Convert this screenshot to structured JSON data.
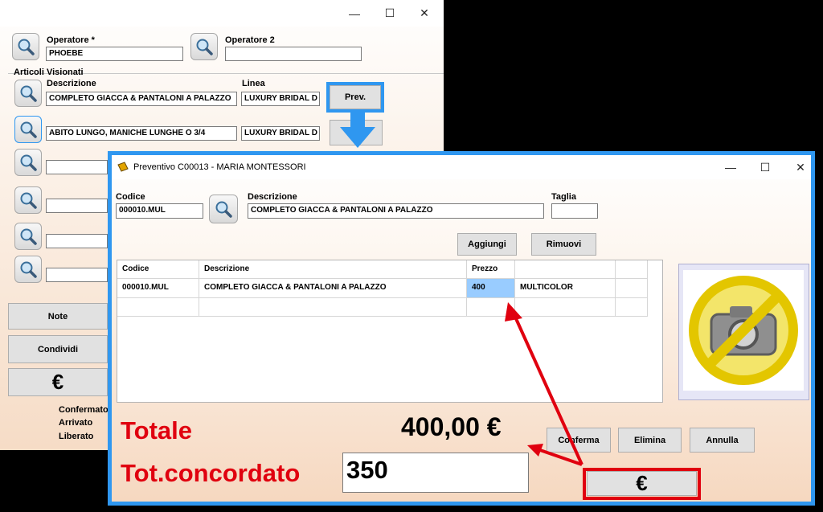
{
  "main_window": {
    "operatore_label": "Operatore *",
    "operatore_value": "PHOEBE",
    "operatore2_label": "Operatore 2",
    "operatore2_value": "",
    "group_label": "Articoli Visionati",
    "col_descrizione": "Descrizione",
    "col_linea": "Linea",
    "articles": [
      {
        "descrizione": "COMPLETO GIACCA & PANTALONI A PALAZZO",
        "linea": "LUXURY BRIDAL D"
      },
      {
        "descrizione": "ABITO LUNGO, MANICHE LUNGHE O 3/4",
        "linea": "LUXURY BRIDAL D"
      },
      {
        "descrizione": ""
      },
      {
        "descrizione": ""
      },
      {
        "descrizione": ""
      },
      {
        "descrizione": ""
      }
    ],
    "prev_button": "Prev.",
    "note_button": "Note",
    "condividi_button": "Condividi",
    "euro_button": "€",
    "status": [
      "Confermato",
      "Arrivato",
      "Liberato"
    ]
  },
  "dialog": {
    "title": "Preventivo C00013 - MARIA  MONTESSORI",
    "codice_label": "Codice",
    "codice_value": "000010.MUL",
    "descrizione_label": "Descrizione",
    "descrizione_value": "COMPLETO GIACCA & PANTALONI A PALAZZO",
    "taglia_label": "Taglia",
    "taglia_value": "",
    "aggiungi_button": "Aggiungi",
    "rimuovi_button": "Rimuovi",
    "table": {
      "headers": [
        "Codice",
        "Descrizione",
        "Prezzo",
        ""
      ],
      "rows": [
        [
          "000010.MUL",
          "COMPLETO GIACCA & PANTALONI A PALAZZO",
          "400",
          "MULTICOLOR"
        ]
      ]
    },
    "totale_label": "Totale",
    "totale_value": "400,00 €",
    "tot_concordato_label": "Tot.concordato",
    "tot_concordato_value": "350",
    "conferma_button": "Conferma",
    "elimina_button": "Elimina",
    "annulla_button": "Annulla",
    "euro_button": "€"
  },
  "colors": {
    "highlight_blue": "#2f97f0",
    "annotation_red": "#e0000f",
    "selected_cell": "#99ccff"
  }
}
